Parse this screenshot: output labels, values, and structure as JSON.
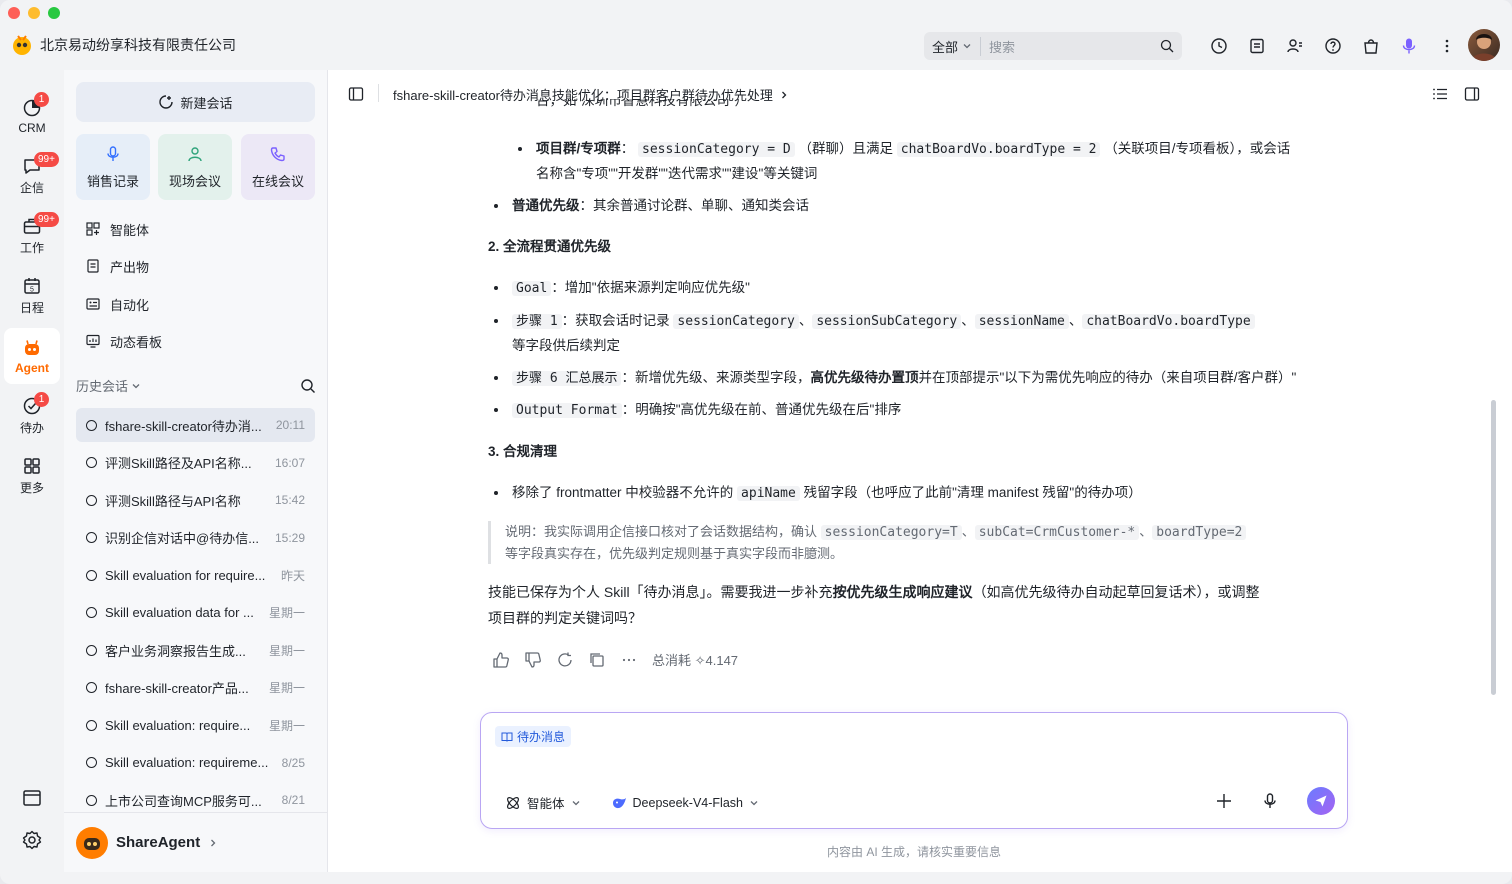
{
  "app": {
    "company": "北京易动纷享科技有限责任公司"
  },
  "search": {
    "scope": "全部",
    "placeholder": "搜索"
  },
  "rail": {
    "items": [
      {
        "label": "CRM",
        "badge": "1"
      },
      {
        "label": "企信",
        "badge": "99+"
      },
      {
        "label": "工作",
        "badge": "99+"
      },
      {
        "label": "日程",
        "badge": ""
      },
      {
        "label": "Agent",
        "badge": ""
      },
      {
        "label": "待办",
        "badge": "1"
      },
      {
        "label": "更多",
        "badge": ""
      }
    ]
  },
  "sidebar": {
    "new_chat": "新建会话",
    "quick": [
      "销售记录",
      "现场会议",
      "在线会议"
    ],
    "nav": [
      "智能体",
      "产出物",
      "自动化",
      "动态看板"
    ],
    "history_label": "历史会话",
    "history": [
      {
        "title": "fshare-skill-creator待办消...",
        "time": "20:11"
      },
      {
        "title": "评测Skill路径及API名称...",
        "time": "16:07"
      },
      {
        "title": "评测Skill路径与API名称",
        "time": "15:42"
      },
      {
        "title": "识别企信对话中@待办信...",
        "time": "15:29"
      },
      {
        "title": "Skill evaluation for require...",
        "time": "昨天"
      },
      {
        "title": "Skill evaluation data for ...",
        "time": "星期一"
      },
      {
        "title": "客户业务洞察报告生成...",
        "time": "星期一"
      },
      {
        "title": "fshare-skill-creator产品...",
        "time": "星期一"
      },
      {
        "title": "Skill evaluation: require...",
        "time": "星期一"
      },
      {
        "title": "Skill evaluation: requireme...",
        "time": "8/25"
      },
      {
        "title": "上市公司查询MCP服务可...",
        "time": "8/21"
      }
    ],
    "agent_name": "ShareAgent"
  },
  "main": {
    "breadcrumb": "fshare-skill-creator待办消息技能优化：项目群客户群待办优先处理",
    "truncated_top": "台，如\"深圳市智慧科技有限公司\"）",
    "project_group": {
      "label": "项目群/专项群",
      "code1": "sessionCategory = D",
      "mid": "（群聊）且满足",
      "code2": "chatBoardVo.boardType = 2",
      "tail": "（关联项目/专项看板），或会话",
      "line2": "名称含\"专项\"\"开发群\"\"迭代需求\"\"建设\"等关键词"
    },
    "normal": {
      "label": "普通优先级",
      "text": "：其余普通讨论群、单聊、通知类会话"
    },
    "section2": "2. 全流程贯通优先级",
    "goal": {
      "code": "Goal",
      "text": "：增加\"依据来源判定响应优先级\""
    },
    "step1": {
      "code": "步骤 1",
      "pre": "：获取会话时记录",
      "c1": "sessionCategory",
      "c2": "sessionSubCategory",
      "c3": "sessionName",
      "c4": "chatBoardVo.boardType",
      "line2": "等字段供后续判定"
    },
    "step6": {
      "code": "步骤 6 汇总展示",
      "pre": "：新增优先级、来源类型字段，",
      "bold": "高优先级待办置顶",
      "tail": "并在顶部提示\"以下为需优先响应的待办（来自项目群/客户群）\""
    },
    "output": {
      "code": "Output Format",
      "text": "：明确按\"高优先级在前、普通优先级在后\"排序"
    },
    "section3": "3. 合规清理",
    "cleanup": {
      "pre": "移除了 frontmatter 中校验器不允许的",
      "code": "apiName",
      "tail": "残留字段（也呼应了此前\"清理 manifest 残留\"的待办项）"
    },
    "note": {
      "pre": "说明：我实际调用企信接口核对了会话数据结构，确认",
      "c1": "sessionCategory=T",
      "c2": "subCat=CrmCustomer-*",
      "c3": "boardType=2",
      "line2": "等字段真实存在，优先级判定规则基于真实字段而非臆测。"
    },
    "closing": {
      "pre": "技能已保存为个人 Skill「待办消息」。需要我进一步补充",
      "bold": "按优先级生成响应建议",
      "tail": "（如高优先级待办自动起草回复话术），或调整",
      "line2": "项目群的判定关键词吗？"
    },
    "cost": "总消耗 ✧4.147"
  },
  "composer": {
    "tag": "待办消息",
    "agent": "智能体",
    "model": "Deepseek-V4-Flash"
  },
  "disclaimer": "内容由 AI 生成，请核实重要信息",
  "colors": {
    "accent": "#ff6a00",
    "badge": "#f54a45",
    "link": "#245bdb"
  }
}
